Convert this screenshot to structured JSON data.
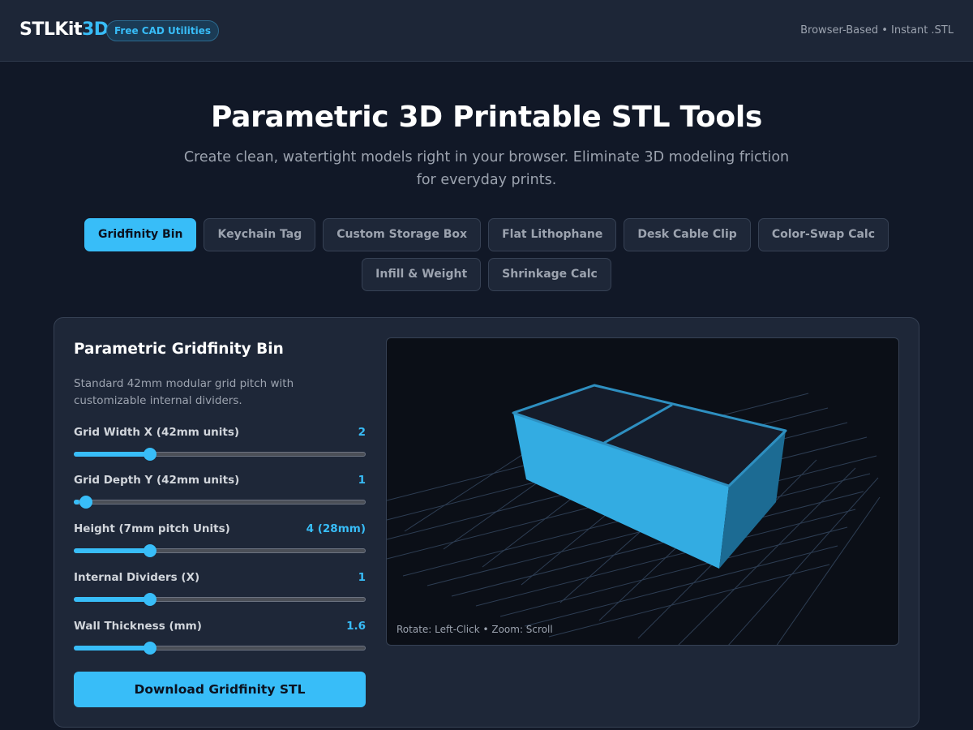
{
  "header": {
    "logo_main": "STLKit",
    "logo_accent": "3D",
    "badge": "Free CAD Utilities",
    "tagline": "Browser-Based • Instant .STL"
  },
  "hero": {
    "title": "Parametric 3D Printable STL Tools",
    "subtitle": "Create clean, watertight models right in your browser. Eliminate 3D modeling friction for everyday prints."
  },
  "tabs": [
    {
      "label": "Gridfinity Bin",
      "active": true
    },
    {
      "label": "Keychain Tag",
      "active": false
    },
    {
      "label": "Custom Storage Box",
      "active": false
    },
    {
      "label": "Flat Lithophane",
      "active": false
    },
    {
      "label": "Desk Cable Clip",
      "active": false
    },
    {
      "label": "Color-Swap Calc",
      "active": false
    },
    {
      "label": "Infill & Weight",
      "active": false
    },
    {
      "label": "Shrinkage Calc",
      "active": false
    }
  ],
  "panel": {
    "title": "Parametric Gridfinity Bin",
    "description": "Standard 42mm modular grid pitch with customizable internal dividers.",
    "controls": [
      {
        "label": "Grid Width X (42mm units)",
        "value": "2",
        "level": 0.25
      },
      {
        "label": "Grid Depth Y (42mm units)",
        "value": "1",
        "level": 0.02
      },
      {
        "label": "Height (7mm pitch Units)",
        "value": "4 (28mm)",
        "level": 0.25
      },
      {
        "label": "Internal Dividers (X)",
        "value": "1",
        "level": 0.25
      },
      {
        "label": "Wall Thickness (mm)",
        "value": "1.6",
        "level": 0.25
      }
    ],
    "download_label": "Download Gridfinity STL",
    "viewport_hint": "Rotate: Left-Click • Zoom: Scroll"
  },
  "colors": {
    "accent": "#38bdf8",
    "background": "#111827",
    "panel": "#1e2738",
    "viewport": "#0b0f17"
  }
}
